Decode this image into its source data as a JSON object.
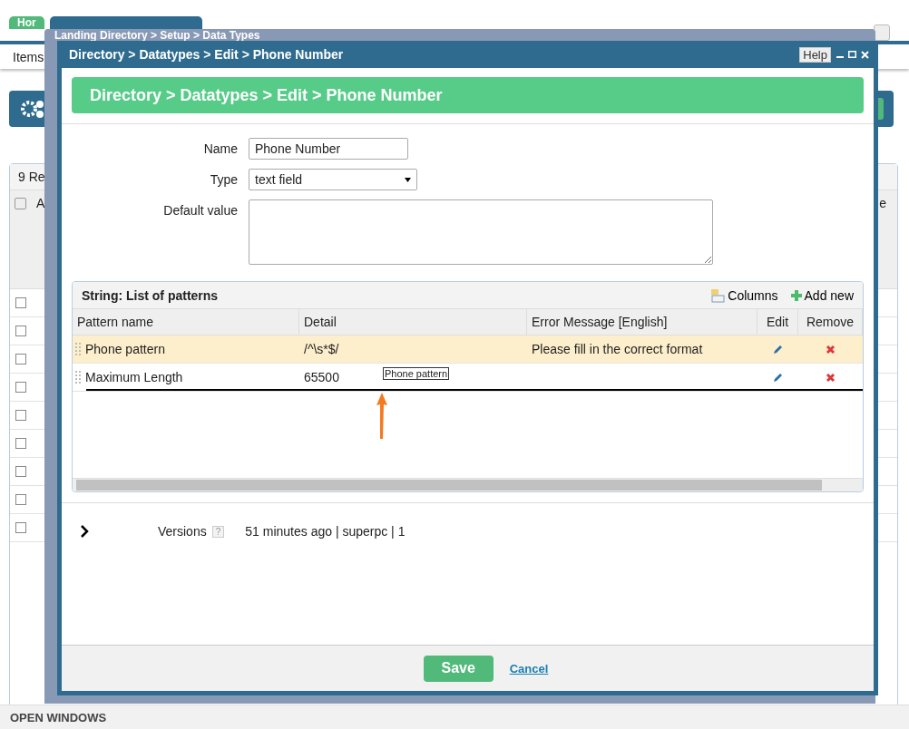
{
  "background": {
    "tabs": [
      {
        "label": "Hor",
        "selected": false
      },
      {
        "selected": true
      }
    ],
    "toolbar_label": "Items",
    "grid": {
      "record_count": "9 Re",
      "select_all_checked": false,
      "column_1": "A",
      "column_2": "e",
      "rows": [
        {
          "checked": false
        },
        {
          "checked": false
        },
        {
          "checked": false
        },
        {
          "checked": false
        },
        {
          "checked": false
        },
        {
          "checked": false
        },
        {
          "checked": false
        },
        {
          "checked": false
        },
        {
          "checked": false
        }
      ]
    }
  },
  "back_window": {
    "title": "Landing Directory > Setup > Data Types"
  },
  "dialog": {
    "title": "Directory > Datatypes > Edit > Phone Number",
    "help": "Help",
    "header": "Directory > Datatypes > Edit > Phone Number",
    "form": {
      "name_label": "Name",
      "name_value": "Phone Number",
      "type_label": "Type",
      "type_value": "text field",
      "default_label": "Default value"
    },
    "patterns": {
      "title": "String: List of patterns",
      "columns_button": "Columns",
      "add_button": "Add new",
      "columns": [
        "Pattern name",
        "Detail",
        "Error Message [English]",
        "Edit",
        "Remove"
      ],
      "rows": [
        {
          "name": "Phone pattern",
          "detail": "/^\\s*$/",
          "error": "Please fill in the correct format",
          "selected": true
        },
        {
          "name": "Maximum Length",
          "detail": "65500",
          "selected": false
        }
      ],
      "drag_tooltip": "Phone pattern"
    },
    "versions": {
      "expanded": false,
      "label": "Versions",
      "help": "?",
      "value": "51 minutes ago | superpc | 1"
    },
    "footer": {
      "save": "Save",
      "cancel": "Cancel"
    }
  },
  "status_bar": {
    "label": "OPEN WINDOWS"
  }
}
